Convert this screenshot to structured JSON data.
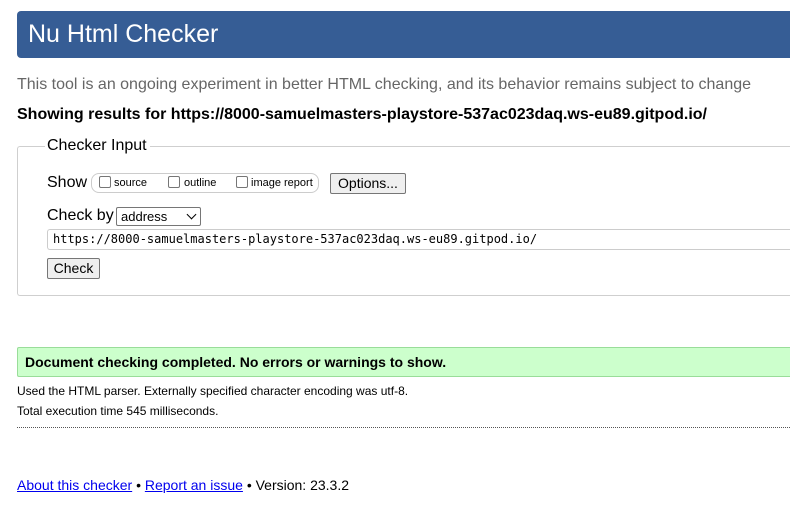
{
  "header": {
    "title": "Nu Html Checker"
  },
  "intro": {
    "text": "This tool is an ongoing experiment in better HTML checking, and its behavior remains subject to change"
  },
  "results_heading": "Showing results for https://8000-samuelmasters-playstore-537ac023daq.ws-eu89.gitpod.io/",
  "checker_input": {
    "legend": "Checker Input",
    "show_label": "Show",
    "show_options": [
      {
        "label": "source",
        "checked": false
      },
      {
        "label": "outline",
        "checked": false
      },
      {
        "label": "image report",
        "checked": false
      }
    ],
    "options_button": "Options...",
    "check_by_label": "Check by",
    "check_by_selected": "address",
    "url_value": "https://8000-samuelmasters-playstore-537ac023daq.ws-eu89.gitpod.io/",
    "check_button": "Check"
  },
  "result": {
    "success_message": "Document checking completed. No errors or warnings to show.",
    "parser_note": "Used the HTML parser. Externally specified character encoding was utf-8.",
    "execution_time": "Total execution time 545 milliseconds."
  },
  "footer": {
    "about_link": "About this checker",
    "separator": "•",
    "report_link": "Report an issue",
    "version_text": "Version: 23.3.2"
  },
  "colors": {
    "banner": "#365d95",
    "success_bg": "#ccffcc",
    "link": "#0000ee"
  }
}
